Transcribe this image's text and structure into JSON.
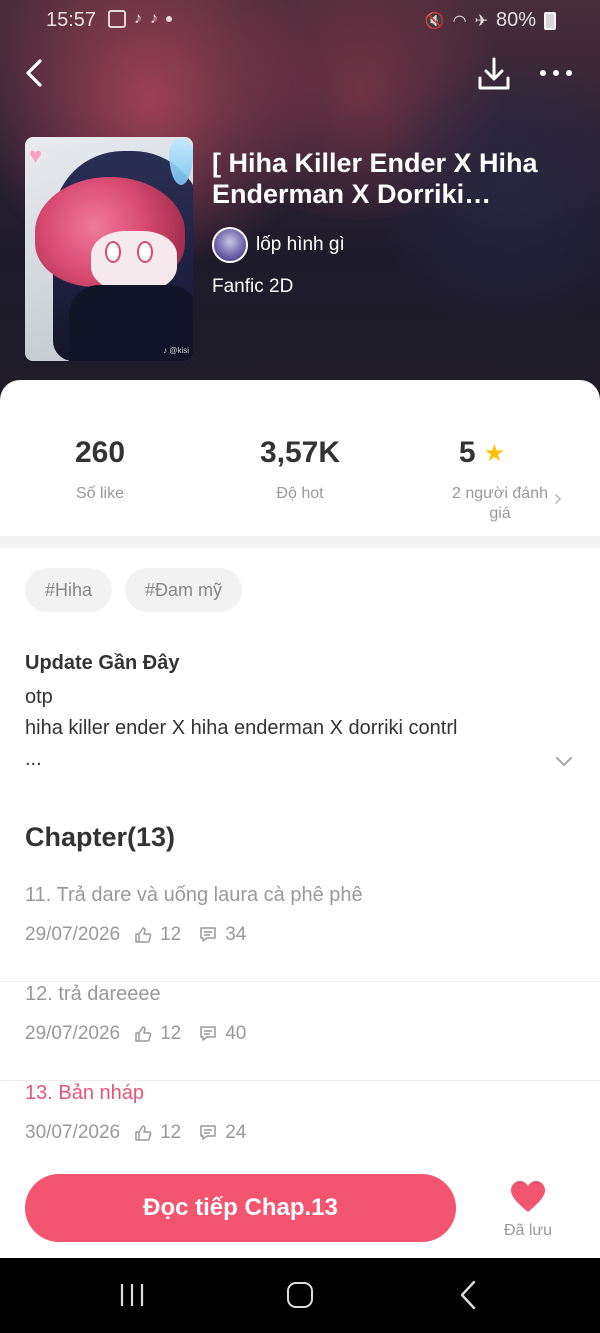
{
  "status_bar": {
    "time": "15:57",
    "battery": "80%"
  },
  "story": {
    "title": "[ Hiha Killer Ender X Hiha Enderman X Dorriki Control...",
    "author": "lốp hình gì",
    "genre": "Fanfic 2D"
  },
  "stats": {
    "likes": {
      "value": "260",
      "label": "Số like"
    },
    "hot": {
      "value": "3,57K",
      "label": "Độ hot"
    },
    "rating": {
      "value": "5",
      "label": "2 người đánh giá"
    }
  },
  "tags": [
    "#Hiha",
    "#Đam mỹ"
  ],
  "description": {
    "heading": "Update Gần Đây",
    "lines": [
      "otp",
      "hiha killer ender X hiha enderman X dorriki contrl",
      "..."
    ]
  },
  "chapters_header": "Chapter(13)",
  "chapters": [
    {
      "title": "11. Trả dare và uống laura cà phê phê",
      "date": "29/07/2026",
      "likes": "12",
      "comments": "34"
    },
    {
      "title": "12. trả dareeee",
      "date": "29/07/2026",
      "likes": "12",
      "comments": "40"
    },
    {
      "title": "13. Bản nháp",
      "date": "30/07/2026",
      "likes": "12",
      "comments": "24"
    }
  ],
  "bottom": {
    "read_button": "Đọc tiếp Chap.13",
    "saved_label": "Đã lưu"
  },
  "colors": {
    "accent": "#f3546f",
    "active_chapter": "#e8537a",
    "star": "#ffc107"
  }
}
